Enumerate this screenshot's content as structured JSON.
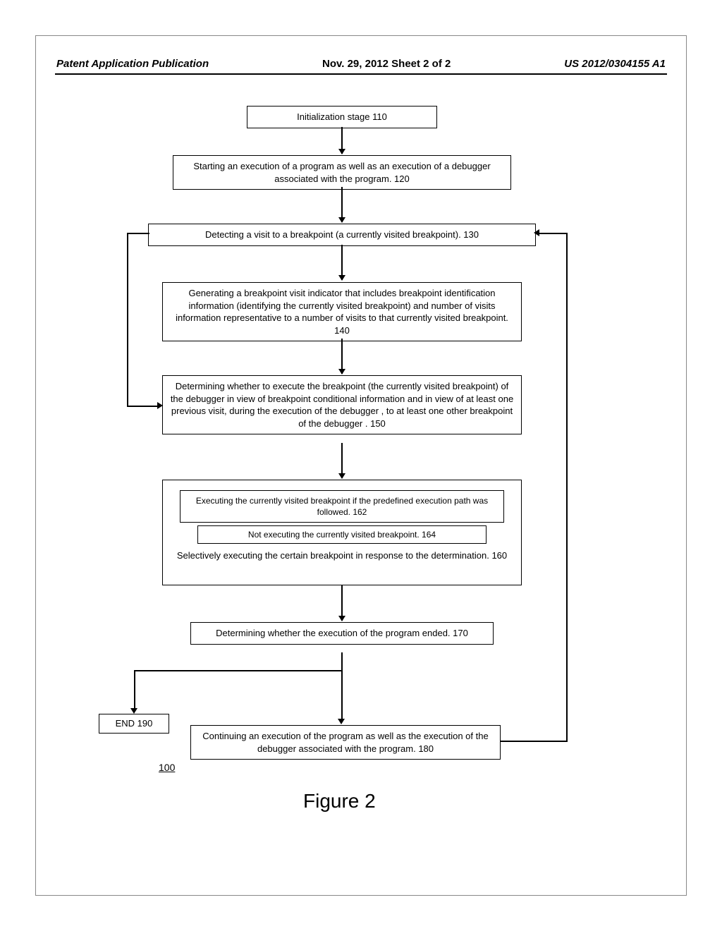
{
  "header": {
    "left": "Patent Application Publication",
    "center": "Nov. 29, 2012  Sheet 2 of 2",
    "right": "US 2012/0304155 A1"
  },
  "boxes": {
    "b110": "Initialization stage 110",
    "b120": "Starting an execution of a program as well as an execution of a debugger  associated with the program. 120",
    "b130": "Detecting a visit to a breakpoint (a currently visited breakpoint). 130",
    "b140": "Generating a breakpoint visit indicator that includes breakpoint identification information (identifying the currently visited breakpoint) and number of visits information representative to a number of visits to that currently visited breakpoint. 140",
    "b150": "Determining whether to execute the breakpoint (the currently visited breakpoint) of the debugger  in view of breakpoint conditional information and in view of at least one previous visit, during the execution of the debugger , to at least one other breakpoint of the debugger . 150",
    "b162": "Executing the currently visited breakpoint if the predefined execution path was followed. 162",
    "b164": "Not executing the currently visited breakpoint. 164",
    "b160": "Selectively executing the certain breakpoint in response to the determination. 160",
    "b170": "Determining whether the execution of the program ended. 170",
    "b190": "END 190",
    "b180": "Continuing an execution of the program as well as the execution of the debugger  associated with the program. 180"
  },
  "ref": "100",
  "figure_label": "Figure 2"
}
